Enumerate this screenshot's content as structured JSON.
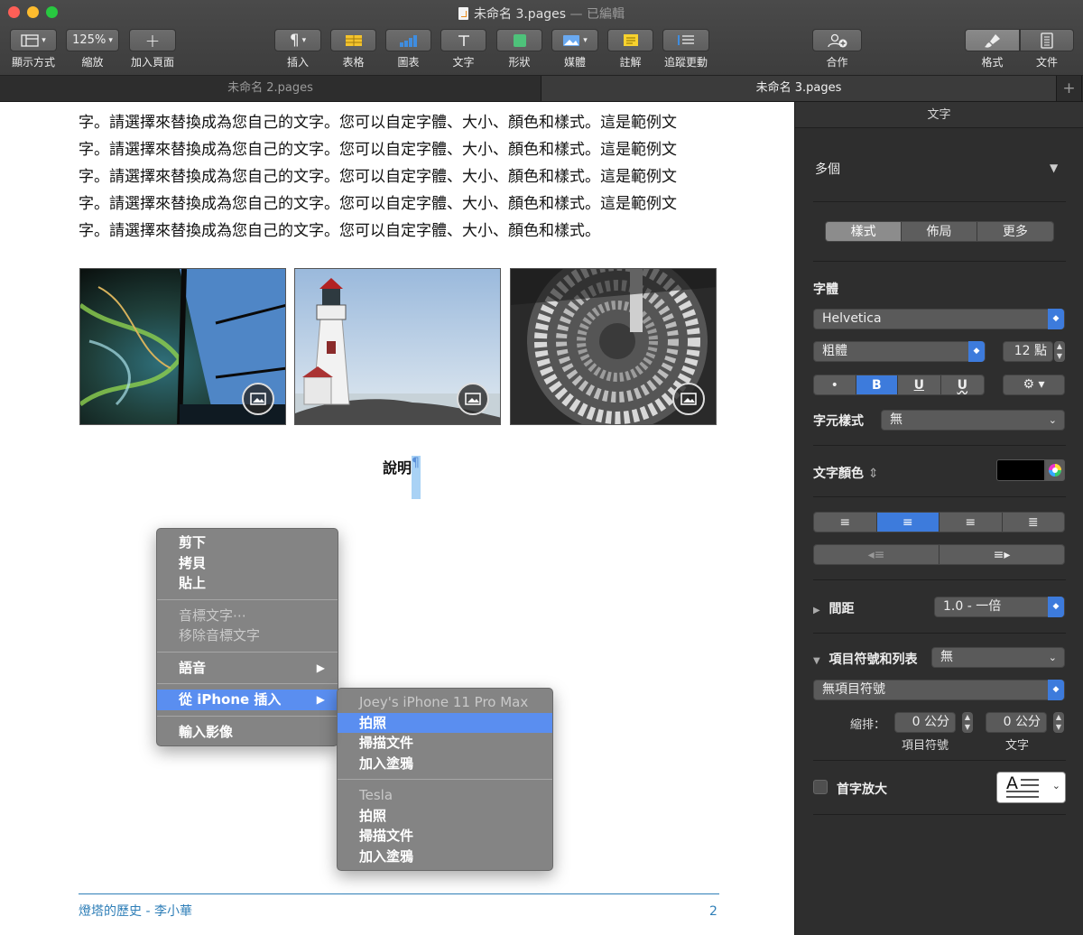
{
  "window": {
    "title": "未命名 3.pages",
    "status": "— 已編輯"
  },
  "toolbar": {
    "view_label": "顯示方式",
    "zoom_value": "125%",
    "zoom_label": "縮放",
    "add_page_label": "加入頁面",
    "insert_label": "插入",
    "table_label": "表格",
    "chart_label": "圖表",
    "text_label": "文字",
    "shape_label": "形狀",
    "media_label": "媒體",
    "comment_label": "註解",
    "track_label": "追蹤更動",
    "collab_label": "合作",
    "format_label": "格式",
    "document_label": "文件"
  },
  "tabs": [
    {
      "label": "未命名 2.pages"
    },
    {
      "label": "未命名 3.pages"
    }
  ],
  "document": {
    "paragraph_lines": [
      "字。請選擇來替換成為您自己的文字。您可以自定字體、大小、顏色和樣式。這是範例文",
      "字。請選擇來替換成為您自己的文字。您可以自定字體、大小、顏色和樣式。這是範例文",
      "字。請選擇來替換成為您自己的文字。您可以自定字體、大小、顏色和樣式。這是範例文",
      "字。請選擇來替換成為您自己的文字。您可以自定字體、大小、顏色和樣式。這是範例文",
      "字。請選擇來替換成為您自己的文字。您可以自定字體、大小、顏色和樣式。"
    ],
    "caption": "說明",
    "pilcrow": "¶",
    "footer_left": "燈塔的歷史 - 李小華",
    "footer_page": "2"
  },
  "context_menu": {
    "cut": "剪下",
    "copy": "拷貝",
    "paste": "貼上",
    "phonetic": "音標文字⋯",
    "remove_phonetic": "移除音標文字",
    "speech": "語音",
    "insert_from_iphone": "從 iPhone 插入",
    "import_image": "輸入影像"
  },
  "submenu": {
    "device1": "Joey's iPhone 11 Pro Max",
    "device1_items": [
      "拍照",
      "掃描文件",
      "加入塗鴉"
    ],
    "device2": "Tesla",
    "device2_items": [
      "拍照",
      "掃描文件",
      "加入塗鴉"
    ]
  },
  "inspector": {
    "header": "文字",
    "paragraph_style": "多個",
    "tabs": [
      "樣式",
      "佈局",
      "更多"
    ],
    "font_label": "字體",
    "font_family": "Helvetica",
    "font_weight": "粗體",
    "font_size": "12 點",
    "style_buttons": {
      "bullet": "•",
      "bold": "B",
      "underline": "U",
      "strike": "U"
    },
    "char_style_label": "字元樣式",
    "char_style_value": "無",
    "text_color_label": "文字顏色",
    "spacing_label": "間距",
    "spacing_value": "1.0 - 一倍",
    "bullets_label": "項目符號和列表",
    "bullets_value": "無",
    "bullet_type": "無項目符號",
    "indent_label": "縮排：",
    "indent_bullet_value": "0 公分",
    "indent_text_value": "0 公分",
    "indent_bullet_label": "項目符號",
    "indent_text_label": "文字",
    "dropcap_label": "首字放大",
    "dropcap_letter": "A"
  }
}
